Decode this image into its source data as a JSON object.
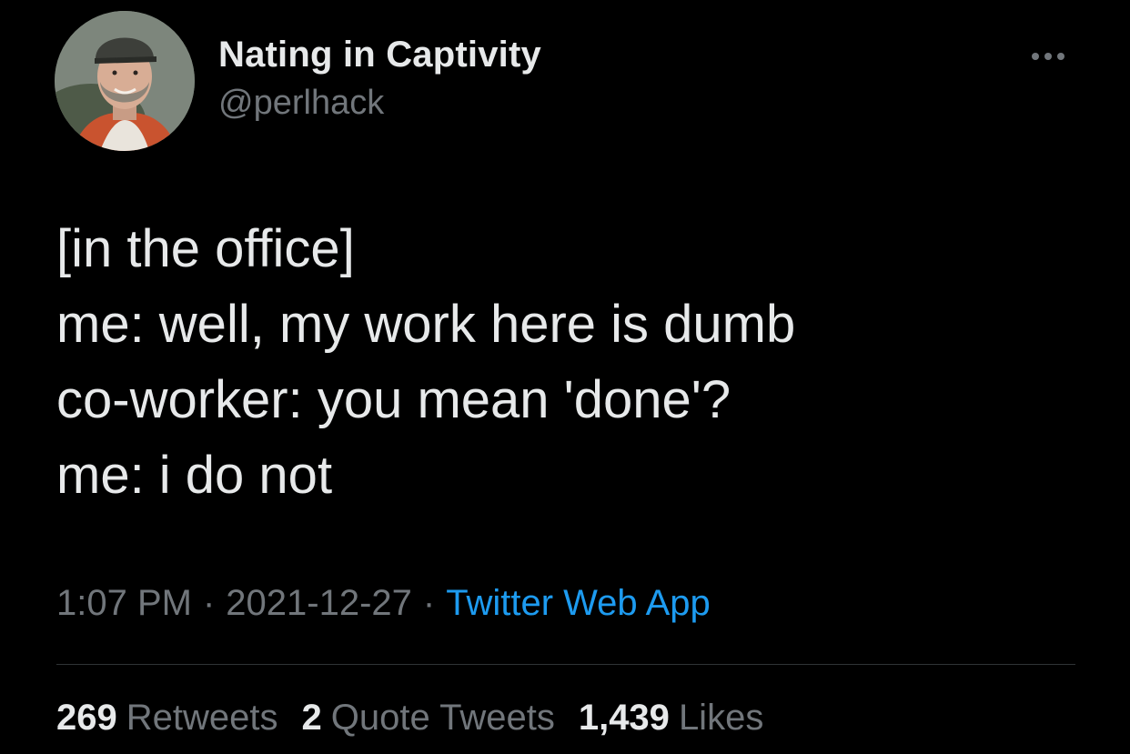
{
  "author": {
    "display_name": "Nating in Captivity",
    "handle": "@perlhack"
  },
  "menu_icon": "more-horizontal-icon",
  "tweet": {
    "lines": [
      "[in the office]",
      "me: well, my work here is dumb",
      "co-worker: you mean 'done'?",
      "me: i do not"
    ]
  },
  "meta": {
    "time": "1:07 PM",
    "separator": "·",
    "date": "2021-12-27",
    "source": "Twitter Web App"
  },
  "stats": {
    "retweets_count": "269",
    "retweets_label": "Retweets",
    "quotes_count": "2",
    "quotes_label": "Quote Tweets",
    "likes_count": "1,439",
    "likes_label": "Likes"
  },
  "colors": {
    "background": "#000000",
    "primary_text": "#e7e9ea",
    "secondary_text": "#71767b",
    "link": "#1d9bf0",
    "divider": "#2f3336"
  }
}
